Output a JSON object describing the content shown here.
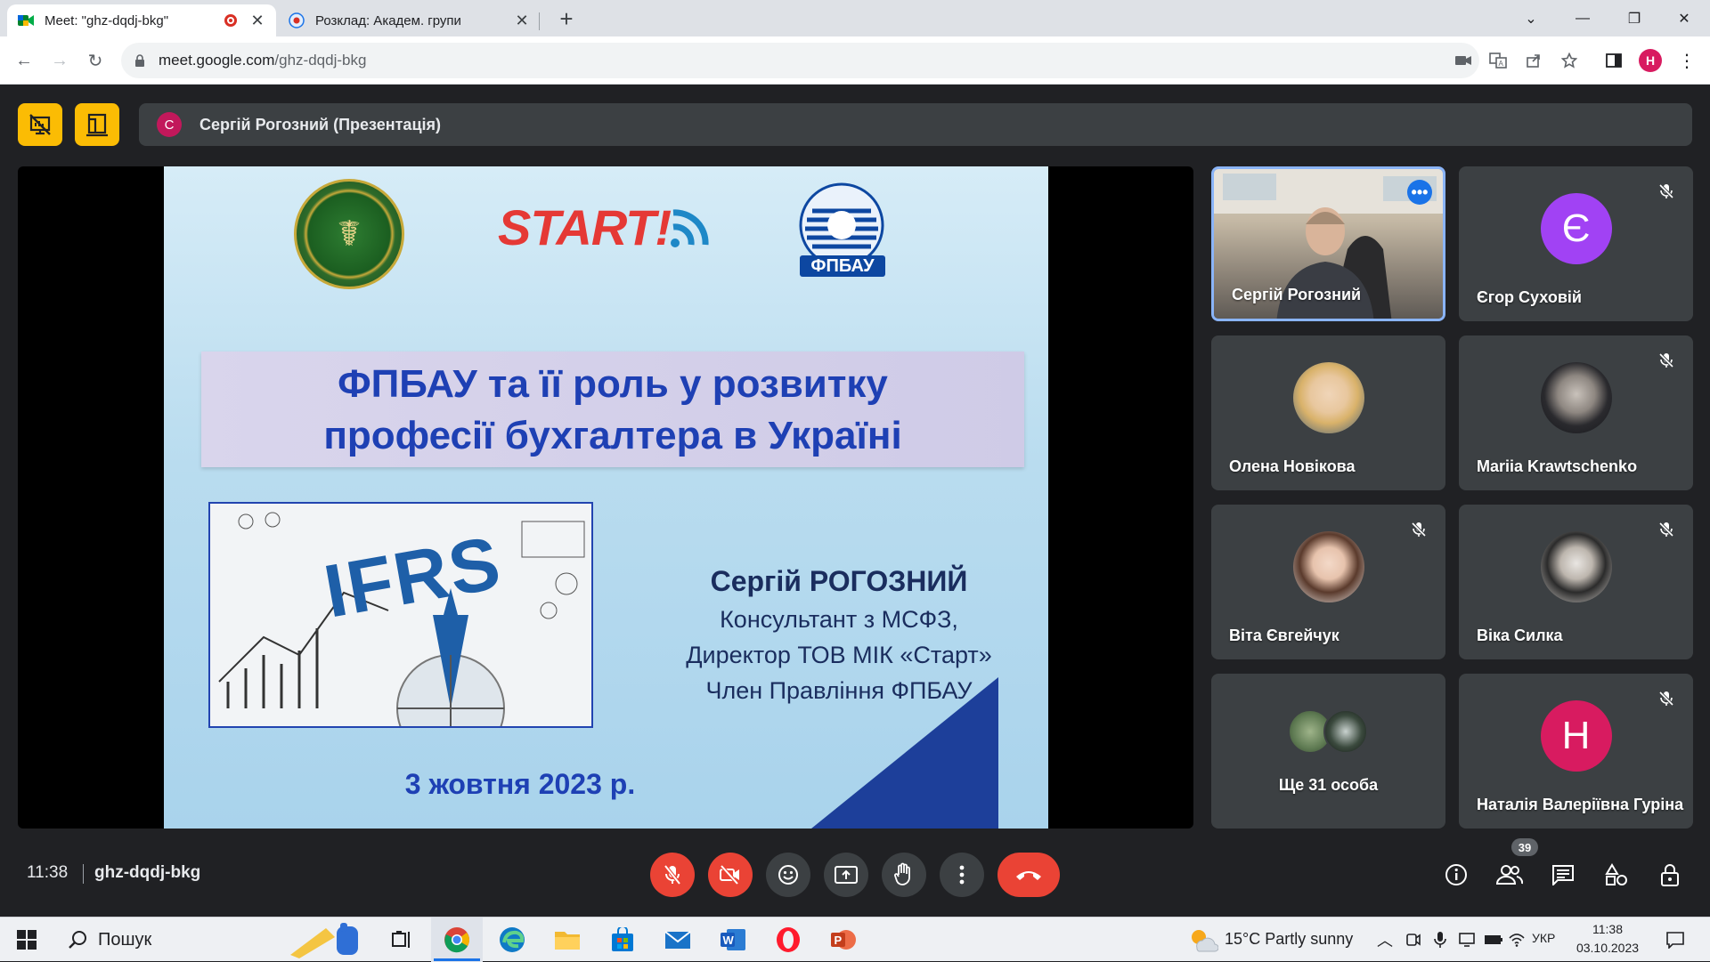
{
  "browser": {
    "tabs": [
      {
        "title": "Meet: \"ghz-dqdj-bkg\"",
        "active": true
      },
      {
        "title": "Розклад: Академ. групи",
        "active": false
      }
    ],
    "url_host": "meet.google.com",
    "url_path": "/ghz-dqdj-bkg",
    "profile_initial": "H"
  },
  "meet": {
    "presenter_initial": "С",
    "presenter_label": "Сергій Рогозний (Презентація)",
    "slide": {
      "logo_text": "START!",
      "org_abbr": "ФПБАУ",
      "title_line1": "ФПБАУ та її роль у розвитку",
      "title_line2": "професії бухгалтера в Україні",
      "image_text": "IFRS",
      "speaker_name": "Сергій РОГОЗНИЙ",
      "speaker_line1": "Консультант з МСФЗ,",
      "speaker_line2": "Директор ТОВ МІК «Старт»",
      "speaker_line3": "Член Правління ФПБАУ",
      "date": "3 жовтня 2023 р."
    },
    "participants": [
      {
        "name": "Сергій Рогозний",
        "muted": false,
        "video": true
      },
      {
        "name": "Єгор Суховій",
        "initial": "Є",
        "color": "#a142f4",
        "muted": true
      },
      {
        "name": "Олена Новікова",
        "muted": false
      },
      {
        "name": "Mariia Krawtschenko",
        "muted": true
      },
      {
        "name": "Віта Євгейчук",
        "muted": true
      },
      {
        "name": "Віка Силка",
        "muted": true
      },
      {
        "name": "Ще 31 особа"
      },
      {
        "name": "Наталія Валеріївна Гуріна",
        "initial": "Н",
        "color": "#d81b60",
        "muted": true
      }
    ],
    "clock": "11:38",
    "meeting_code": "ghz-dqdj-bkg",
    "participant_count": "39"
  },
  "taskbar": {
    "search_label": "Пошук",
    "weather": "15°C  Partly sunny",
    "language": "УКР",
    "time": "11:38",
    "date": "03.10.2023"
  },
  "colors": {
    "meet_bg": "#202124",
    "tile_bg": "#3c4043",
    "accent_yellow": "#fbbc04",
    "danger_red": "#ea4335",
    "active_border": "#8ab4f8"
  }
}
